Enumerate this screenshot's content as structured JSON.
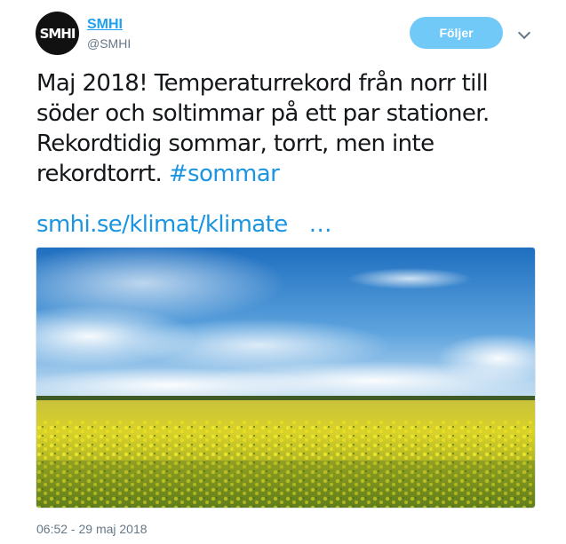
{
  "author": {
    "avatar_text": "SMHI",
    "display_name": "SMHI",
    "handle": "@SMHI"
  },
  "follow_button": {
    "label": "Följer"
  },
  "tweet": {
    "text": "Maj 2018! Temperaturrekord från norr till söder och soltimmar på ett par stationer. Rekordtidig sommar, torrt, men inte rekordtorrt.",
    "hashtag": "#sommar",
    "link_text": "smhi.se/klimat/klimate",
    "link_ellipsis": "…"
  },
  "timestamp": "06:52 - 29 maj 2018",
  "colors": {
    "accent": "#1da1f2",
    "follow_button_bg": "#71c9f8",
    "sky": "#3a86cf",
    "field": "#d8d52a"
  },
  "icons": {
    "menu": "chevron-down-icon"
  }
}
